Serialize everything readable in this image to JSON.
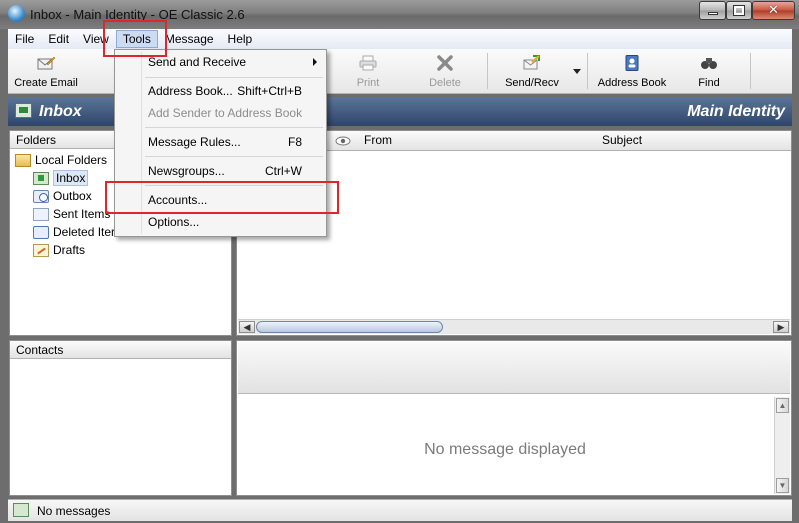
{
  "window": {
    "title": "Inbox - Main Identity - OE Classic 2.6",
    "controls": {
      "minimize": "minimize",
      "maximize": "maximize",
      "close": "✕"
    }
  },
  "menubar": [
    "File",
    "Edit",
    "View",
    "Tools",
    "Message",
    "Help"
  ],
  "toolbar": {
    "create_email": "Create Email",
    "print": "Print",
    "delete": "Delete",
    "send_recv": "Send/Recv",
    "address_book": "Address Book",
    "find": "Find"
  },
  "header": {
    "title": "Inbox",
    "identity": "Main Identity"
  },
  "folders": {
    "heading": "Folders",
    "root": "Local Folders",
    "items": [
      "Inbox",
      "Outbox",
      "Sent Items",
      "Deleted Iter",
      "Drafts"
    ]
  },
  "message_list": {
    "columns": [
      "From",
      "Subject"
    ]
  },
  "contacts": {
    "heading": "Contacts"
  },
  "preview": {
    "empty_text": "No message displayed"
  },
  "status": {
    "text": "No messages"
  },
  "tools_menu": {
    "items": [
      {
        "label": "Send and Receive",
        "shortcut": "",
        "disabled": false,
        "submenu": true
      },
      {
        "label": "Address Book...",
        "shortcut": "Shift+Ctrl+B",
        "disabled": false
      },
      {
        "label": "Add Sender to Address Book",
        "shortcut": "",
        "disabled": true
      },
      {
        "label": "Message Rules...",
        "shortcut": "F8",
        "disabled": false
      },
      {
        "label": "Newsgroups...",
        "shortcut": "Ctrl+W",
        "disabled": false
      },
      {
        "label": "Accounts...",
        "shortcut": "",
        "disabled": false
      },
      {
        "label": "Options...",
        "shortcut": "",
        "disabled": false
      }
    ]
  },
  "colors": {
    "highlight": "#e0262b",
    "band": "#2d4569",
    "menu_active": "#cbdcf2"
  },
  "icons": {
    "create_email": "envelope-pencil-icon",
    "print": "printer-icon",
    "delete": "delete-x-icon",
    "send_recv": "send-receive-icon",
    "address_book": "address-book-icon",
    "find": "binoculars-icon",
    "read_column": "eye-icon"
  }
}
